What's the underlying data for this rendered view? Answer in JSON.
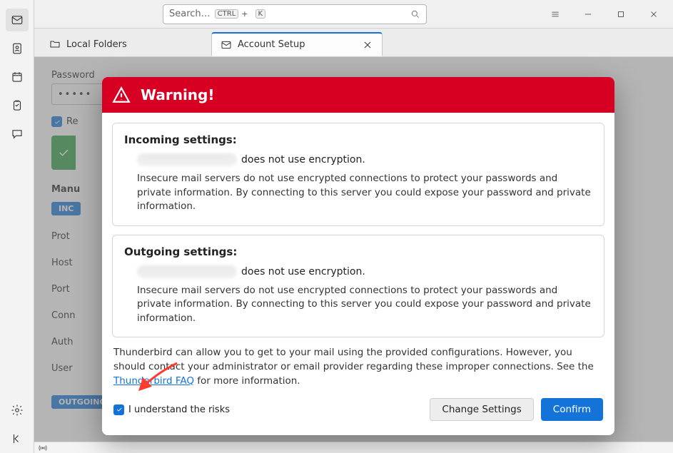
{
  "titlebar": {
    "search_placeholder": "Search…",
    "kbd1": "CTRL",
    "kbd_plus": "+",
    "kbd2": "K"
  },
  "tabs": {
    "local_folders": "Local Folders",
    "account_setup": "Account Setup"
  },
  "background": {
    "password_label": "Password",
    "password_value": "•••••",
    "remember_label": "Re",
    "manual_label": "Manu",
    "incoming_pill": "INC",
    "outgoing_pill": "OUTGOING SERVER",
    "f_protocol": "Prot",
    "f_host": "Host",
    "f_port": "Port",
    "f_conn": "Conn",
    "f_auth": "Auth",
    "f_user": "User"
  },
  "dialog": {
    "title": "Warning!",
    "incoming": {
      "heading": "Incoming settings:",
      "suffix": "does not use encryption.",
      "detail": "Insecure mail servers do not use encrypted connections to protect your passwords and private information. By connecting to this server you could expose your password and private information."
    },
    "outgoing": {
      "heading": "Outgoing settings:",
      "suffix": "does not use encryption.",
      "detail": "Insecure mail servers do not use encrypted connections to protect your passwords and private information. By connecting to this server you could expose your password and private information."
    },
    "info_pre": "Thunderbird can allow you to get to your mail using the provided configurations. However, you should contact your administrator or email provider regarding these improper connections. See the ",
    "info_link": "Thunderbird FAQ",
    "info_post": " for more information.",
    "understand": "I understand the risks",
    "change_btn": "Change Settings",
    "confirm_btn": "Confirm"
  }
}
